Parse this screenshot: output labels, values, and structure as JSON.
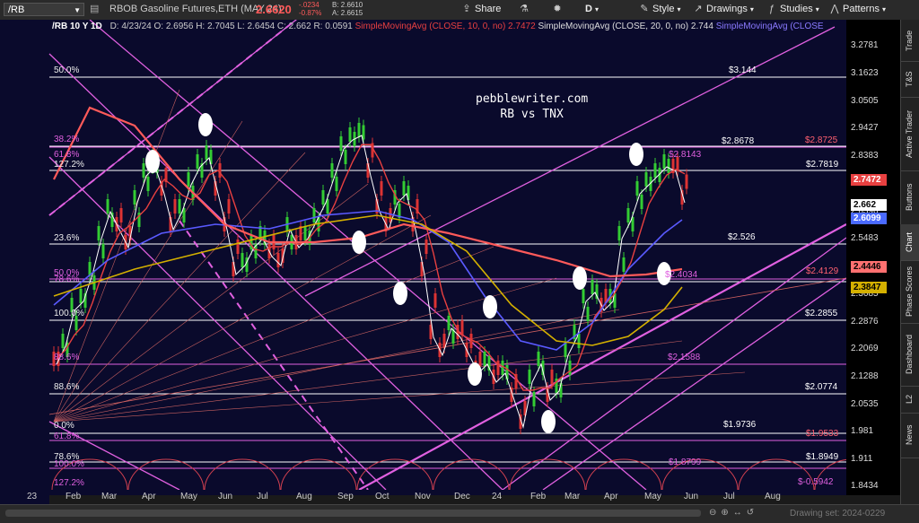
{
  "header": {
    "symbol": "/RB",
    "instrument_name": "RBOB Gasoline Futures,ETH (MAY 24)",
    "last_price": "2.6620",
    "change": "-.0234",
    "change_pct": "-0.87%",
    "bid": "B: 2.6610",
    "ask": "A: 2.6615",
    "toolbar": {
      "share": "Share",
      "period": "D",
      "style": "Style",
      "drawings": "Drawings",
      "studies": "Studies",
      "patterns": "Patterns"
    }
  },
  "infobar": {
    "title": "/RB 10 Y 1D",
    "date": "D: 4/23/24",
    "open": "O: 2.6956",
    "high": "H: 2.7045",
    "low": "L: 2.6454",
    "close": "C: 2.662",
    "range": "R: 0.0591",
    "sma10": "SimpleMovingAvg (CLOSE, 10, 0, no) 2.7472",
    "sma20": "SimpleMovingAvg (CLOSE, 20, 0, no) 2.744",
    "sma_next": "SimpleMovingAvg (CLOSE"
  },
  "watermark": {
    "line1": "pebblewriter.com",
    "line2": "RB vs TNX"
  },
  "colors": {
    "background": "#0a0a2c",
    "magenta": "#e060e0",
    "sma10": "#e84040",
    "sma_yellow": "#d4b000",
    "sma_blue": "#5a5aff",
    "up": "#33cc33",
    "down": "#dd3333"
  },
  "yaxis": {
    "ticks": [
      "3.2781",
      "3.1623",
      "3.0505",
      "2.9427",
      "2.8383",
      "2.7372",
      "2.6396",
      "2.5483",
      "2.4561",
      "2.3685",
      "2.2876",
      "2.2069",
      "2.1288",
      "2.0535",
      "1.981",
      "1.911",
      "1.8434"
    ],
    "badges": [
      {
        "value": "2.7472",
        "color": "#e84040",
        "fg": "#fff"
      },
      {
        "value": "2.662",
        "color": "#ffffff",
        "fg": "#000"
      },
      {
        "value": "2.6099",
        "color": "#4a6aff",
        "fg": "#fff"
      },
      {
        "value": "2.4446",
        "color": "#ff7070",
        "fg": "#000"
      },
      {
        "value": "2.3847",
        "color": "#d4b000",
        "fg": "#000"
      }
    ]
  },
  "xaxis": {
    "labels": [
      "23",
      "Feb",
      "Mar",
      "Apr",
      "May",
      "Jun",
      "Jul",
      "Aug",
      "Sep",
      "Oct",
      "Nov",
      "Dec",
      "24",
      "Feb",
      "Mar",
      "Apr",
      "May",
      "Jun",
      "Jul",
      "Aug"
    ]
  },
  "fib_labels": [
    {
      "text": "50.0%",
      "cls": ""
    },
    {
      "text": "38.2%",
      "cls": "m"
    },
    {
      "text": "61.8%",
      "cls": "m"
    },
    {
      "text": "127.2%",
      "cls": ""
    },
    {
      "text": "23.6%",
      "cls": ""
    },
    {
      "text": "50.0%",
      "cls": "m"
    },
    {
      "text": "78.6%",
      "cls": "m"
    },
    {
      "text": "100.0%",
      "cls": ""
    },
    {
      "text": "88.6%",
      "cls": "m"
    },
    {
      "text": "88.6%",
      "cls": ""
    },
    {
      "text": "0.0%",
      "cls": ""
    },
    {
      "text": "61.8%",
      "cls": "m"
    },
    {
      "text": "78.6%",
      "cls": ""
    },
    {
      "text": "100.0%",
      "cls": "m"
    },
    {
      "text": "127.2%",
      "cls": "m"
    }
  ],
  "levels": [
    {
      "text": "$3.144",
      "cls": ""
    },
    {
      "text": "$2.8678",
      "cls": ""
    },
    {
      "text": "$2.8725",
      "cls": "r"
    },
    {
      "text": "$2.8143",
      "cls": "p"
    },
    {
      "text": "$2.7819",
      "cls": ""
    },
    {
      "text": "$2.526",
      "cls": ""
    },
    {
      "text": "$2.4129",
      "cls": "r"
    },
    {
      "text": "$2.4034",
      "cls": "p"
    },
    {
      "text": "$2.2855",
      "cls": ""
    },
    {
      "text": "$2.1588",
      "cls": "p"
    },
    {
      "text": "$2.0774",
      "cls": ""
    },
    {
      "text": "$1.9736",
      "cls": ""
    },
    {
      "text": "$1.9533",
      "cls": "r"
    },
    {
      "text": "$1.8949",
      "cls": ""
    },
    {
      "text": "$1.8799",
      "cls": "p"
    },
    {
      "text": "$-0.5942",
      "cls": "p"
    }
  ],
  "right_tabs": [
    "Trade",
    "T&S",
    "Active Trader",
    "Buttons",
    "Chart",
    "Phase Scores",
    "Dashboard",
    "L2",
    "News"
  ],
  "active_tab": "Chart",
  "footer": {
    "drawing_set": "Drawing set: 2024-0229"
  }
}
